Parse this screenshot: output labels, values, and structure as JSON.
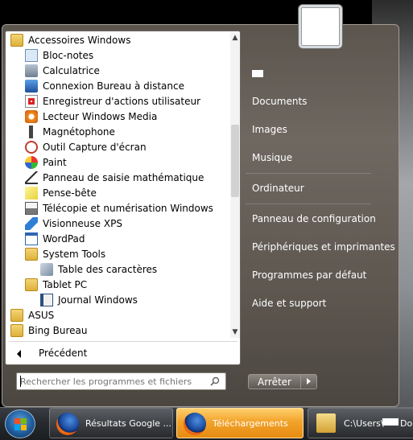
{
  "programs": [
    {
      "label": "Accessoires Windows",
      "icon": "folder-icon",
      "level": 0
    },
    {
      "label": "Bloc-notes",
      "icon": "notepad-icon",
      "level": 1
    },
    {
      "label": "Calculatrice",
      "icon": "calculator-icon",
      "level": 1
    },
    {
      "label": "Connexion Bureau à distance",
      "icon": "remote-desktop-icon",
      "level": 1
    },
    {
      "label": "Enregistreur d'actions utilisateur",
      "icon": "steps-recorder-icon",
      "level": 1
    },
    {
      "label": "Lecteur Windows Media",
      "icon": "media-player-icon",
      "level": 1
    },
    {
      "label": "Magnétophone",
      "icon": "microphone-icon",
      "level": 1
    },
    {
      "label": "Outil Capture d'écran",
      "icon": "snipping-tool-icon",
      "level": 1
    },
    {
      "label": "Paint",
      "icon": "paint-icon",
      "level": 1
    },
    {
      "label": "Panneau de saisie mathématique",
      "icon": "math-input-icon",
      "level": 1
    },
    {
      "label": "Pense-bête",
      "icon": "sticky-notes-icon",
      "level": 1
    },
    {
      "label": "Télécopie et numérisation Windows",
      "icon": "fax-scan-icon",
      "level": 1
    },
    {
      "label": "Visionneuse XPS",
      "icon": "xps-viewer-icon",
      "level": 1
    },
    {
      "label": "WordPad",
      "icon": "wordpad-icon",
      "level": 1
    },
    {
      "label": "System Tools",
      "icon": "folder-icon",
      "level": 1
    },
    {
      "label": "Table des caractères",
      "icon": "character-map-icon",
      "level": 2
    },
    {
      "label": "Tablet PC",
      "icon": "folder-icon",
      "level": 1
    },
    {
      "label": "Journal Windows",
      "icon": "journal-icon",
      "level": 2
    },
    {
      "label": "ASUS",
      "icon": "folder-icon",
      "level": 0
    },
    {
      "label": "Bing Bureau",
      "icon": "folder-icon",
      "level": 0
    }
  ],
  "back_label": "Précédent",
  "search": {
    "placeholder": "Rechercher les programmes et fichiers",
    "value": ""
  },
  "right_pane": {
    "items": [
      "Documents",
      "Images",
      "Musique",
      "Ordinateur",
      "Panneau de configuration",
      "Périphériques et imprimantes",
      "Programmes par défaut",
      "Aide et support"
    ]
  },
  "shutdown_label": "Arrêter",
  "taskbar": {
    "buttons": [
      {
        "label": "Résultats Google ...",
        "icon": "firefox-icon",
        "active": false
      },
      {
        "label": "Téléchargements",
        "icon": "firefox-icon",
        "active": true
      },
      {
        "label": "C:\\Users\\",
        "icon": "folder-icon",
        "active": false
      }
    ],
    "button3_suffix": "Do"
  },
  "colors": {
    "active_task": "#f3a32a",
    "menu_body": "#6f6861",
    "left_pane": "#ffffff"
  }
}
